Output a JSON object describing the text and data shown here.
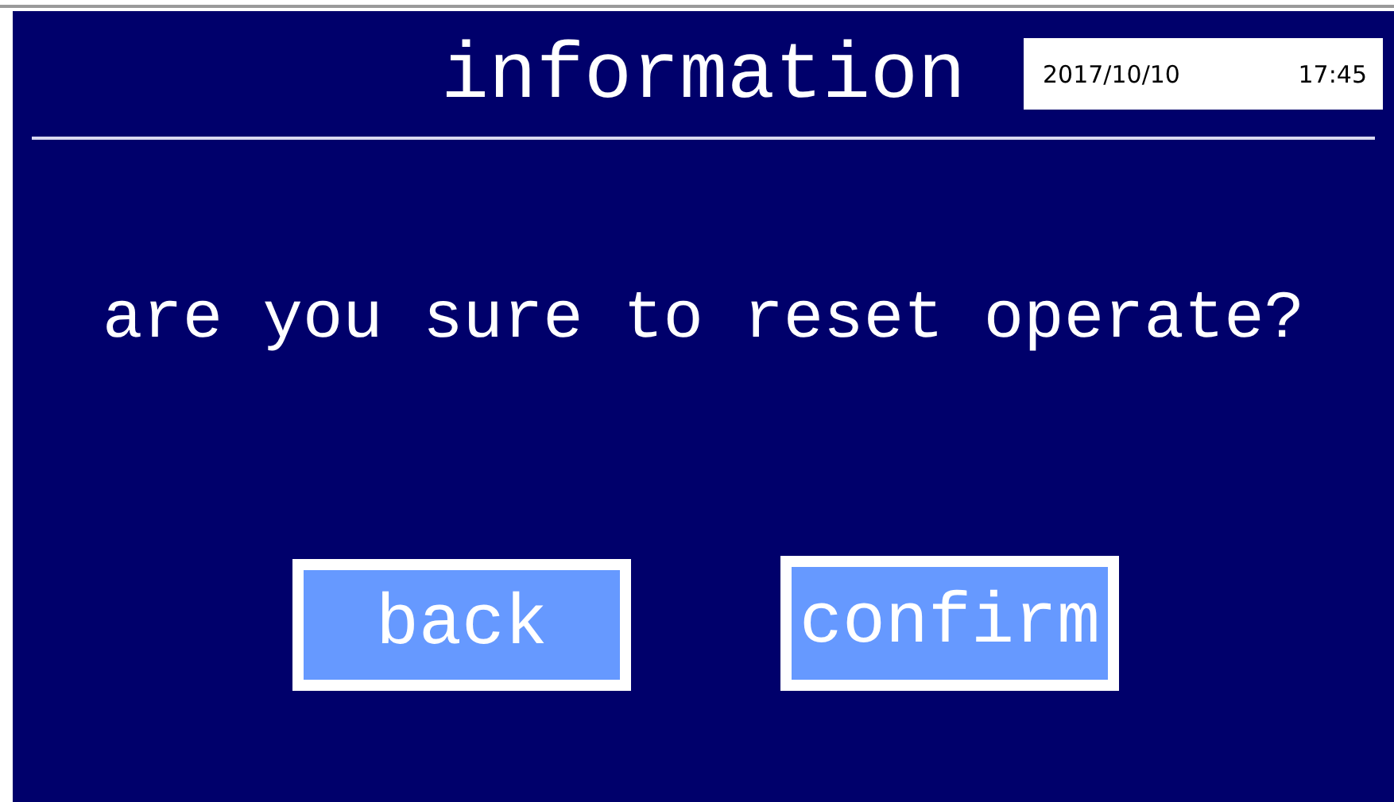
{
  "header": {
    "title": "information",
    "date": "2017/10/10",
    "time": "17:45"
  },
  "message": "are you sure to reset operate?",
  "buttons": [
    {
      "label": "back"
    },
    {
      "label": "confirm"
    }
  ]
}
